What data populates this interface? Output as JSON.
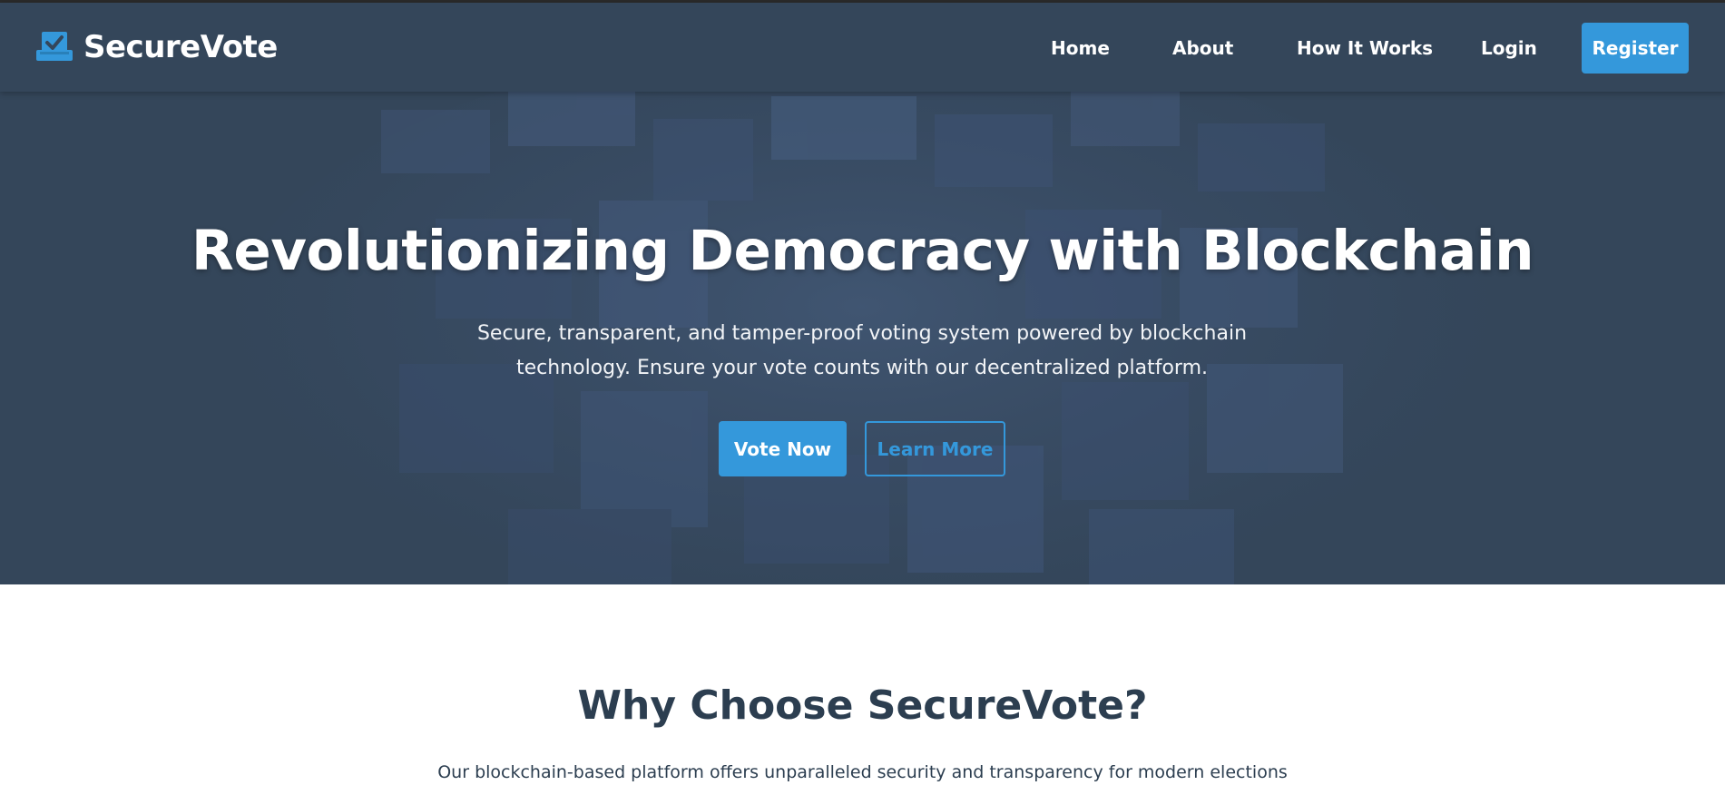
{
  "brand": {
    "name": "SecureVote",
    "icon": "ballot-check-icon",
    "accent": "#3498db"
  },
  "nav": {
    "links": [
      {
        "label": "Home"
      },
      {
        "label": "About"
      },
      {
        "label": "How It Works"
      },
      {
        "label": "Login"
      }
    ],
    "register_label": "Register"
  },
  "hero": {
    "title": "Revolutionizing Democracy with Blockchain",
    "subtitle": "Secure, transparent, and tamper-proof voting system powered by blockchain technology. Ensure your vote counts with our decentralized platform.",
    "primary_button": "Vote Now",
    "secondary_button": "Learn More",
    "background_color": "#34465a"
  },
  "why": {
    "title": "Why Choose SecureVote?",
    "subtitle": "Our blockchain-based platform offers unparalleled security and transparency for modern elections"
  }
}
